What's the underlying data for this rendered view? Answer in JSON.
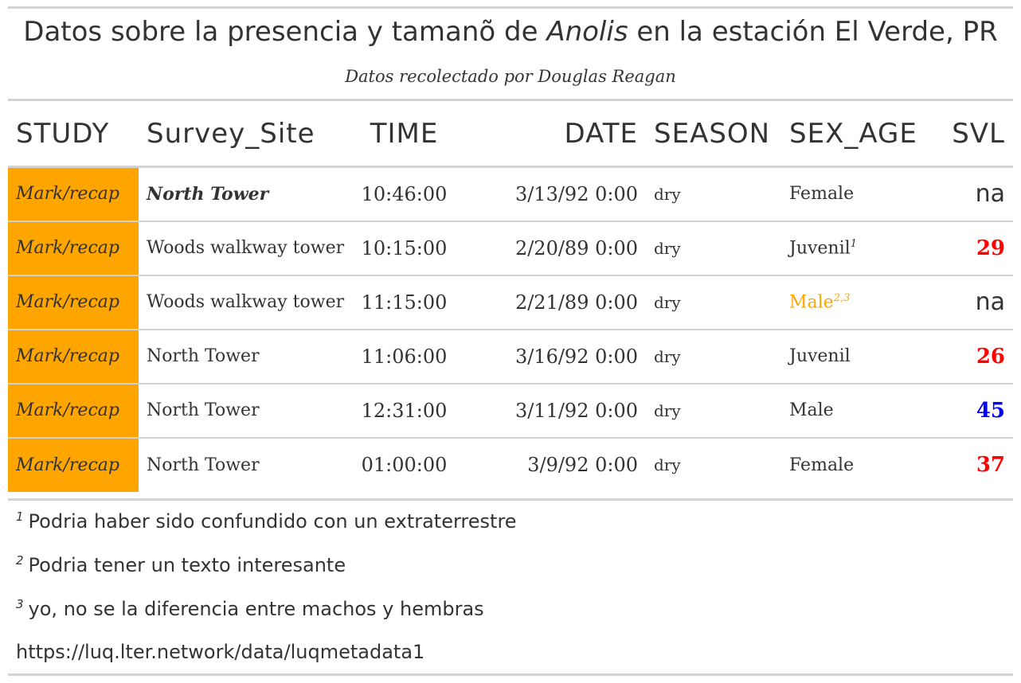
{
  "title": {
    "prefix": "Datos sobre la presencia y tamanõ de ",
    "italic": "Anolis",
    "suffix": " en la estación El Verde, PR"
  },
  "subtitle": "Datos recolectado por Douglas Reagan",
  "colors": {
    "study_bg": "#ffa500",
    "svl_red": "#ff0000",
    "svl_blue": "#0000ff",
    "male_orange": "#ffa500",
    "rule": "#d3d3d3",
    "text": "#333333"
  },
  "table": {
    "columns": [
      "STUDY",
      "Survey_Site",
      "TIME",
      "DATE",
      "SEASON",
      "SEX_AGE",
      "SVL"
    ],
    "rows": [
      {
        "study": "Mark/recap",
        "site": "North Tower",
        "time": "10:46:00",
        "date": "3/13/92 0:00",
        "season": "dry",
        "sex": "Female",
        "sex_marks": "",
        "svl": "na"
      },
      {
        "study": "Mark/recap",
        "site": "Woods walkway tower",
        "time": "10:15:00",
        "date": "2/20/89 0:00",
        "season": "dry",
        "sex": "Juvenil",
        "sex_marks": "1",
        "svl": "29"
      },
      {
        "study": "Mark/recap",
        "site": "Woods walkway tower",
        "time": "11:15:00",
        "date": "2/21/89 0:00",
        "season": "dry",
        "sex": "Male",
        "sex_marks": "2,3",
        "svl": "na"
      },
      {
        "study": "Mark/recap",
        "site": "North Tower",
        "time": "11:06:00",
        "date": "3/16/92 0:00",
        "season": "dry",
        "sex": "Juvenil",
        "sex_marks": "",
        "svl": "26"
      },
      {
        "study": "Mark/recap",
        "site": "North Tower",
        "time": "12:31:00",
        "date": "3/11/92 0:00",
        "season": "dry",
        "sex": "Male",
        "sex_marks": "",
        "svl": "45"
      },
      {
        "study": "Mark/recap",
        "site": "North Tower",
        "time": "01:00:00",
        "date": "3/9/92 0:00",
        "season": "dry",
        "sex": "Female",
        "sex_marks": "",
        "svl": "37"
      }
    ]
  },
  "footnotes": [
    {
      "mark": "1",
      "text": "Podria haber sido confundido con un extraterrestre"
    },
    {
      "mark": "2",
      "text": "Podria tener un texto interesante"
    },
    {
      "mark": "3",
      "text": "yo, no se la diferencia entre machos y hembras"
    }
  ],
  "source": "https://luq.lter.network/data/luqmetadata1"
}
